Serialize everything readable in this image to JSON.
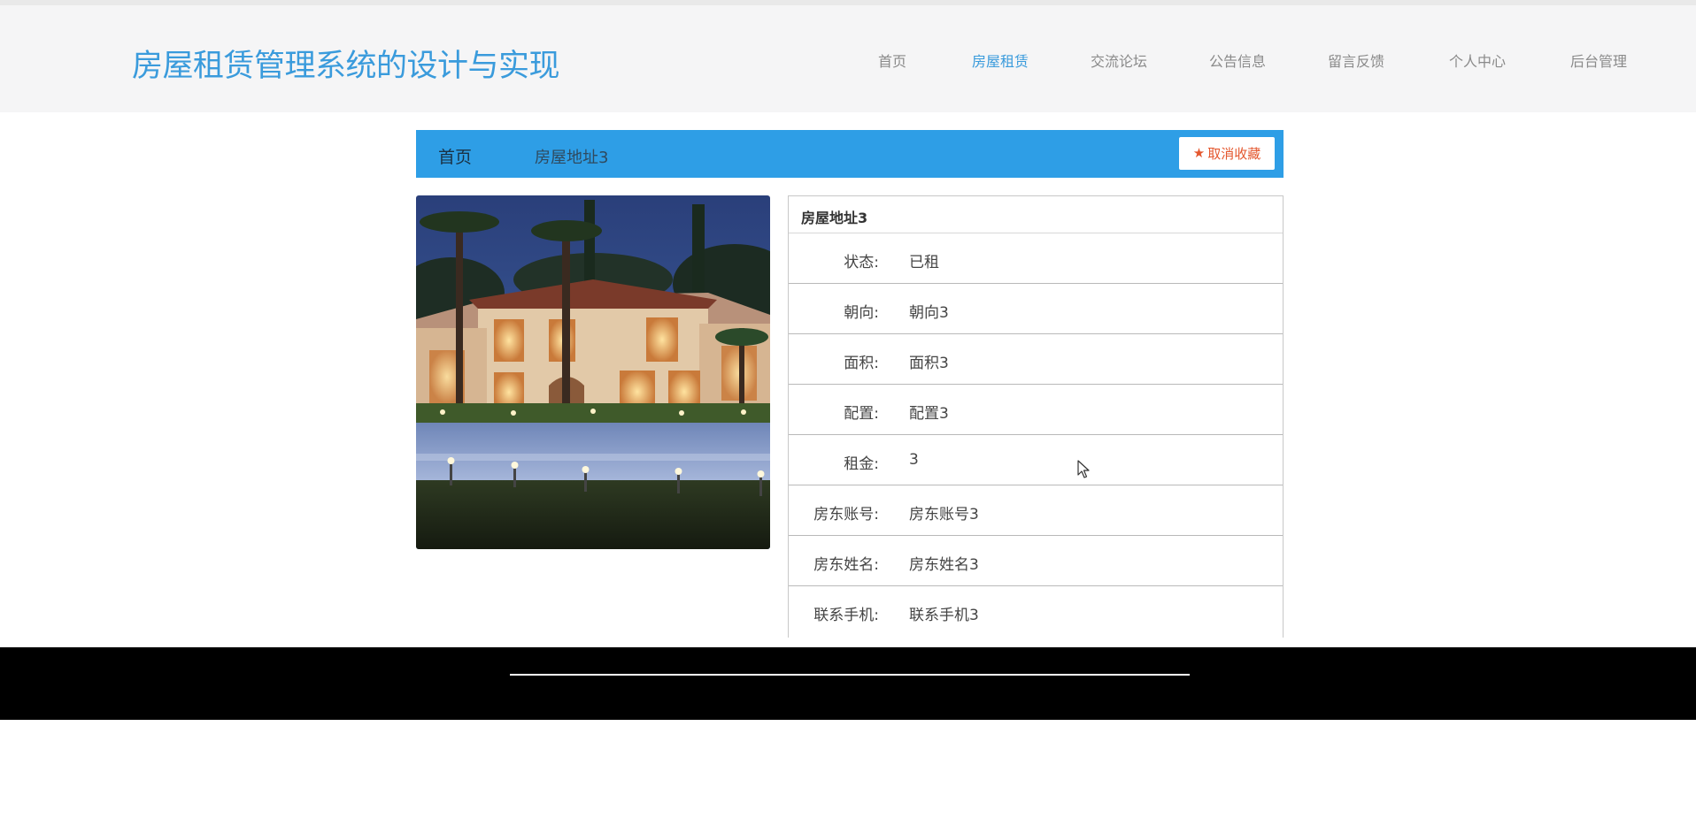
{
  "site": {
    "title": "房屋租赁管理系统的设计与实现"
  },
  "nav": {
    "items": [
      {
        "label": "首页"
      },
      {
        "label": "房屋租赁",
        "active": true
      },
      {
        "label": "交流论坛"
      },
      {
        "label": "公告信息"
      },
      {
        "label": "留言反馈"
      },
      {
        "label": "个人中心"
      },
      {
        "label": "后台管理"
      }
    ]
  },
  "breadcrumb": {
    "home": "首页",
    "current": "房屋地址3"
  },
  "actions": {
    "unfavorite_label": "取消收藏",
    "unfavorite_icon": "star-icon"
  },
  "detail": {
    "title": "房屋地址3",
    "rows": [
      {
        "label": "状态:",
        "value": "已租"
      },
      {
        "label": "朝向:",
        "value": "朝向3"
      },
      {
        "label": "面积:",
        "value": "面积3"
      },
      {
        "label": "配置:",
        "value": "配置3"
      },
      {
        "label": "租金:",
        "value": "3"
      },
      {
        "label": "房东账号:",
        "value": "房东账号3"
      },
      {
        "label": "房东姓名:",
        "value": "房东姓名3"
      },
      {
        "label": "联系手机:",
        "value": "联系手机3"
      }
    ]
  },
  "colors": {
    "accent": "#3a9bdc",
    "breadcrumb_bg": "#2e9ee6",
    "favorite": "#e4572e",
    "footer_bg": "#000000"
  }
}
